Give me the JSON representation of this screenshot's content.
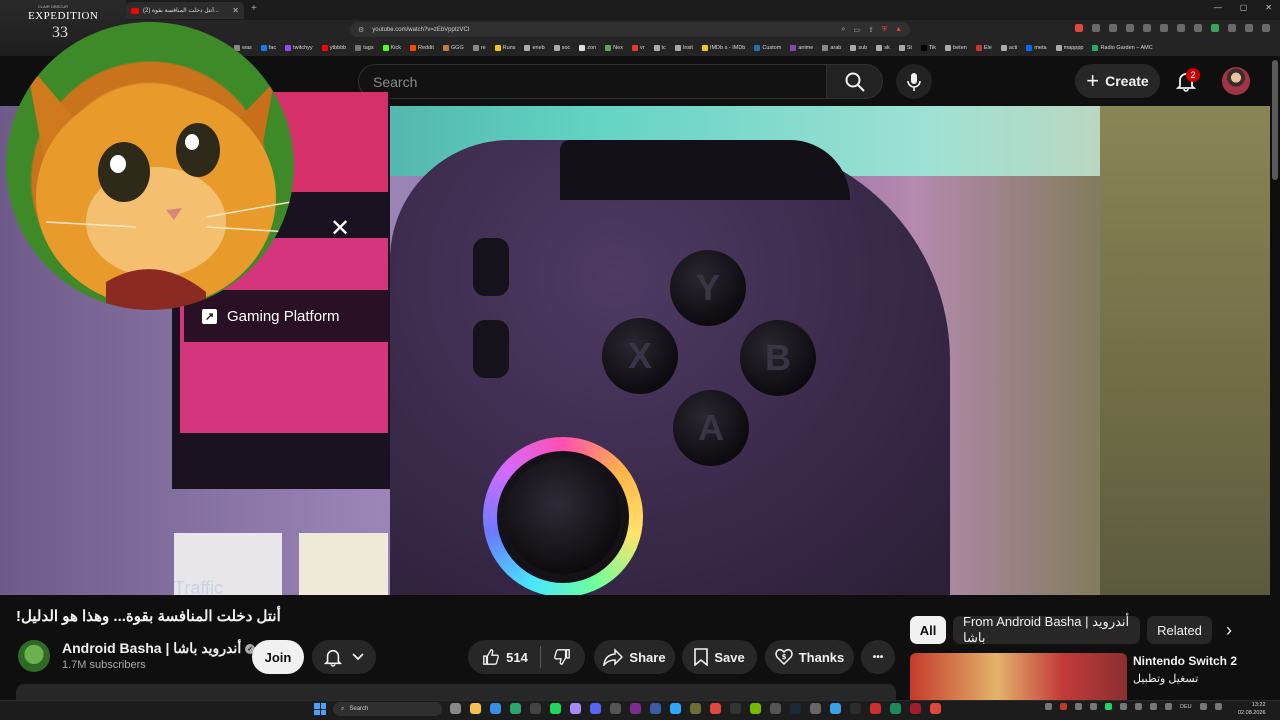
{
  "browser": {
    "tab_title": "(2) أنتل دخلت المنافسة بقوة...",
    "url": "youtube.com/watch?v=zEbVpptzVCI",
    "new_tab": "+",
    "bookmarks": [
      "was",
      "fac",
      "twitchyy",
      "ytbbbb",
      "tags",
      "Kick",
      "Reddit",
      "GGG",
      "re",
      "Runs",
      "eneb",
      "soc",
      "zon",
      "Nex",
      "vr",
      "tc",
      "Insit",
      "IMDb s - IMDb",
      "Custom",
      "anime",
      "arab",
      "sub",
      "sk",
      "St",
      "Tik",
      "beten",
      "Ele",
      "acti",
      "meta",
      "mapppp",
      "Radio Garden – AMC"
    ]
  },
  "game_overlay": {
    "small": "CLAIR OBSCUR",
    "title": "EXPEDITION",
    "number": "33"
  },
  "header": {
    "search_placeholder": "Search",
    "create_label": "Create",
    "notification_count": "2"
  },
  "video": {
    "close_glyph": "✕",
    "gaming_label": "Gaming Platform",
    "traffic_text": "Traffic",
    "buttons": [
      "Y",
      "X",
      "B",
      "A"
    ]
  },
  "meta": {
    "title": "!أنتل دخلت المنافسة بقوة... وهذا هو الدليل",
    "channel_name": "Android Basha | أندرويد باشا",
    "subscribers": "1.7M subscribers",
    "join_label": "Join",
    "like_count": "514",
    "share_label": "Share",
    "save_label": "Save",
    "thanks_label": "Thanks",
    "more_label": "•••"
  },
  "chips": {
    "all": "All",
    "from_channel": "From Android Basha | أندرويد باشا",
    "related": "Related"
  },
  "recommendation": {
    "title": "Nintendo Switch 2",
    "subtitle": "تسغيل وتطبيل"
  },
  "taskbar": {
    "search_label": "Search",
    "language": "DEU",
    "time": "13:22",
    "date": "02.08.2026"
  },
  "colors": {
    "accent_red": "#ff0000",
    "badge_red": "#cc0000",
    "background": "#0f0f0f"
  }
}
